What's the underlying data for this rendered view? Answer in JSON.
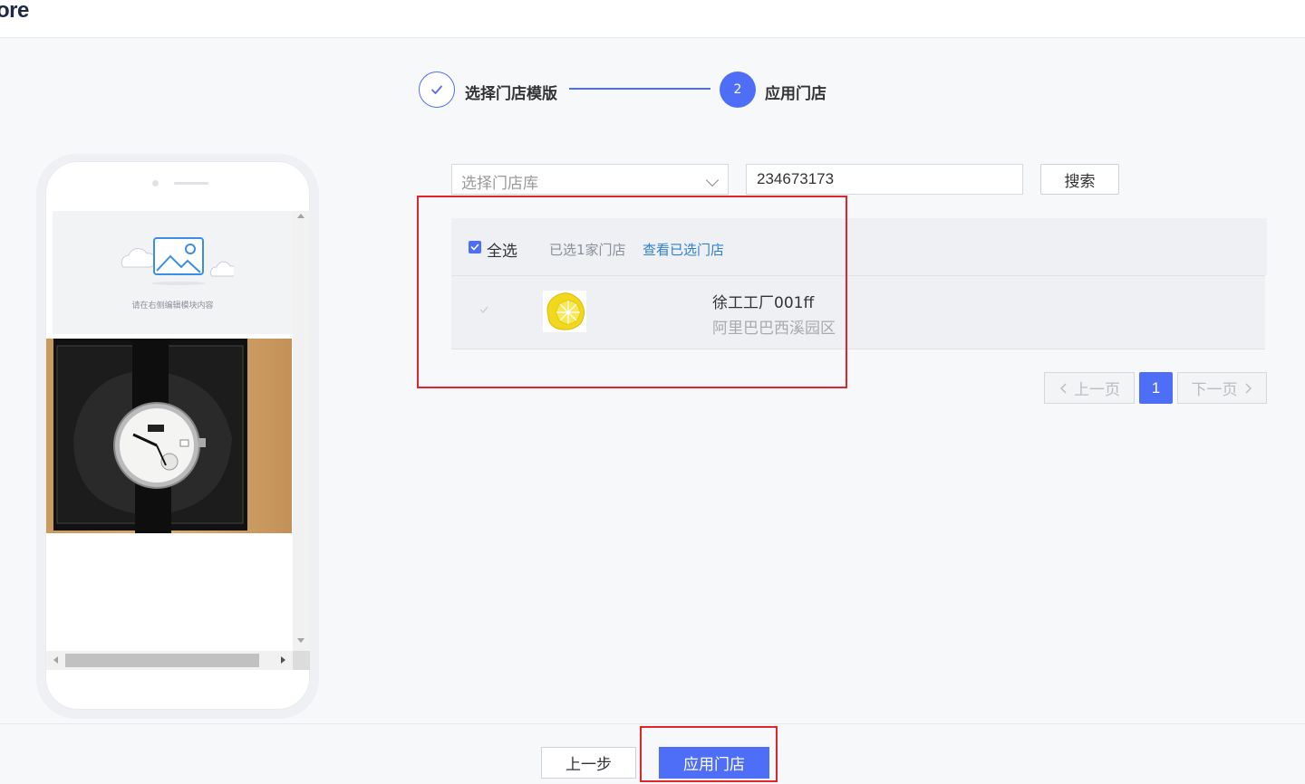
{
  "header": {
    "logo_text": "ore"
  },
  "steps": [
    {
      "label": "选择门店模版",
      "status": "done",
      "icon": "check-icon"
    },
    {
      "label": "应用门店",
      "number": "2",
      "status": "active"
    }
  ],
  "preview": {
    "placeholder_text": "请在右侧编辑模块内容",
    "image_icon": "image-placeholder-icon",
    "photo": "watch-photo"
  },
  "filters": {
    "store_library_placeholder": "选择门店库",
    "search_value": "234673173",
    "search_button": "搜索"
  },
  "store_list": {
    "select_all_label": "全选",
    "select_all_checked": true,
    "selected_count_text": "已选1家门店",
    "view_selected_link": "查看已选门店",
    "rows": [
      {
        "name": "徐工工厂001ff",
        "address": "阿里巴巴西溪园区",
        "thumbnail": "lemon-image",
        "checked": true
      }
    ]
  },
  "pagination": {
    "prev_label": "上一页",
    "current_page": "1",
    "next_label": "下一页"
  },
  "footer": {
    "prev_step_label": "上一步",
    "apply_label": "应用门店"
  },
  "colors": {
    "primary": "#4f6ef7",
    "link": "#2f7fd3",
    "annotation_red": "#e3242b"
  }
}
